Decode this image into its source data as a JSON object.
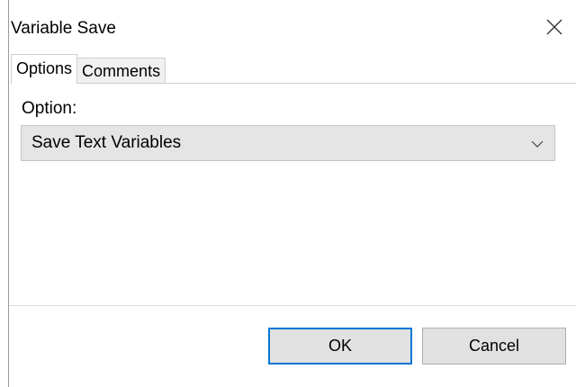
{
  "window": {
    "title": "Variable Save"
  },
  "tabs": [
    {
      "label": "Options",
      "active": true
    },
    {
      "label": "Comments",
      "active": false
    }
  ],
  "options_panel": {
    "option_label": "Option:",
    "option_value": "Save Text Variables"
  },
  "footer": {
    "ok_label": "OK",
    "cancel_label": "Cancel"
  },
  "icons": {
    "close": "close-icon",
    "dropdown": "chevron-down-icon"
  },
  "colors": {
    "focus_border": "#0078d7",
    "button_face": "#e1e1e1",
    "select_face": "#e5e5e5"
  }
}
